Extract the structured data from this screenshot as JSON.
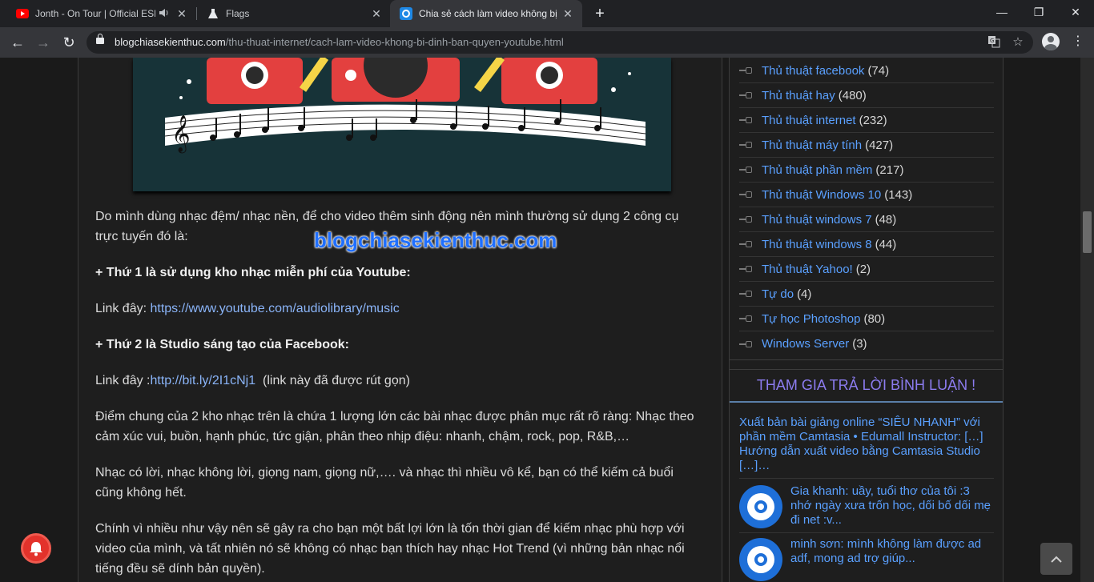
{
  "browser": {
    "tabs": [
      {
        "title": "Jonth - On Tour | Official ESL",
        "icon": "youtube-icon",
        "audio": true
      },
      {
        "title": "Flags",
        "icon": "flask-icon"
      },
      {
        "title": "Chia sẻ cách làm video không bị",
        "icon": "site-icon",
        "active": true
      }
    ],
    "url_host": "blogchiasekienthuc.com",
    "url_path": "/thu-thuat-internet/cach-lam-video-khong-bi-dinh-ban-quyen-youtube.html"
  },
  "article": {
    "para1": "Do mình dùng nhạc đệm/ nhạc nền, để cho video thêm sinh động nên mình thường sử dụng 2 công cụ trực tuyến đó là:",
    "watermark": "blogchiasekienthuc.com",
    "h1": "+ Thứ 1 là sử dụng kho nhạc miễn phí của Youtube:",
    "link1_prefix": "Link đây: ",
    "link1": "https://www.youtube.com/audiolibrary/music",
    "h2": "+ Thứ 2 là Studio sáng tạo của Facebook:",
    "link2_prefix": "Link đây :",
    "link2": "http://bit.ly/2I1cNj1",
    "link2_suffix": "  (link này đã được rút gọn)",
    "para2": "Điểm chung của 2 kho nhạc trên là chứa 1 lượng lớn các bài nhạc được phân mục rất rõ ràng: Nhạc theo cảm xúc vui, buồn, hạnh phúc, tức giận, phân theo nhịp điệu: nhanh, chậm, rock, pop, R&B,…",
    "para3": "Nhạc có lời, nhạc không lời, giọng nam, giọng nữ,…. và nhạc thì nhiều vô kể, bạn có thể kiếm cả buổi cũng không hết.",
    "para4": "Chính vì nhiều như vậy nên sẽ gây ra cho bạn một bất lợi lớn là tốn thời gian để kiếm nhạc phù hợp với video của mình, và tất nhiên nó sẽ không có nhạc bạn thích hay nhạc Hot Trend (vì những bản nhạc nổi tiếng đều sẽ dính bản quyền)."
  },
  "sidebar": {
    "categories": [
      {
        "label": "Thủ thuật facebook",
        "count": "(74)"
      },
      {
        "label": "Thủ thuật hay",
        "count": "(480)"
      },
      {
        "label": "Thủ thuật internet",
        "count": "(232)"
      },
      {
        "label": "Thủ thuật máy tính",
        "count": "(427)"
      },
      {
        "label": "Thủ thuật phần mềm",
        "count": "(217)"
      },
      {
        "label": "Thủ thuật Windows 10",
        "count": "(143)"
      },
      {
        "label": "Thủ thuật windows 7",
        "count": "(48)"
      },
      {
        "label": "Thủ thuật windows 8",
        "count": "(44)"
      },
      {
        "label": "Thủ thuật Yahoo!",
        "count": "(2)"
      },
      {
        "label": "Tự do",
        "count": "(4)"
      },
      {
        "label": "Tự học Photoshop",
        "count": "(80)"
      },
      {
        "label": "Windows Server",
        "count": "(3)"
      }
    ],
    "comments_heading": "THAM GIA TRẢ LỜI BÌNH LUẬN !",
    "first_comment": "Xuất bản bài giảng online “SIÊU NHANH” với phần mềm Camtasia • Edumall Instructor: […] Hướng dẫn xuất video bằng Camtasia Studio […]…",
    "comments": [
      {
        "text": "Gia khanh: uầy, tuổi thơ của tôi :3 nhớ ngày xưa trốn học, dối bố dối mẹ đi net :v..."
      },
      {
        "text": "minh sơn: mình không làm được ad adf, mong ad trợ giúp..."
      }
    ]
  },
  "colors": {
    "link": "#5aa0ff",
    "heading": "#8c7cf0",
    "bell": "#e3322b"
  }
}
